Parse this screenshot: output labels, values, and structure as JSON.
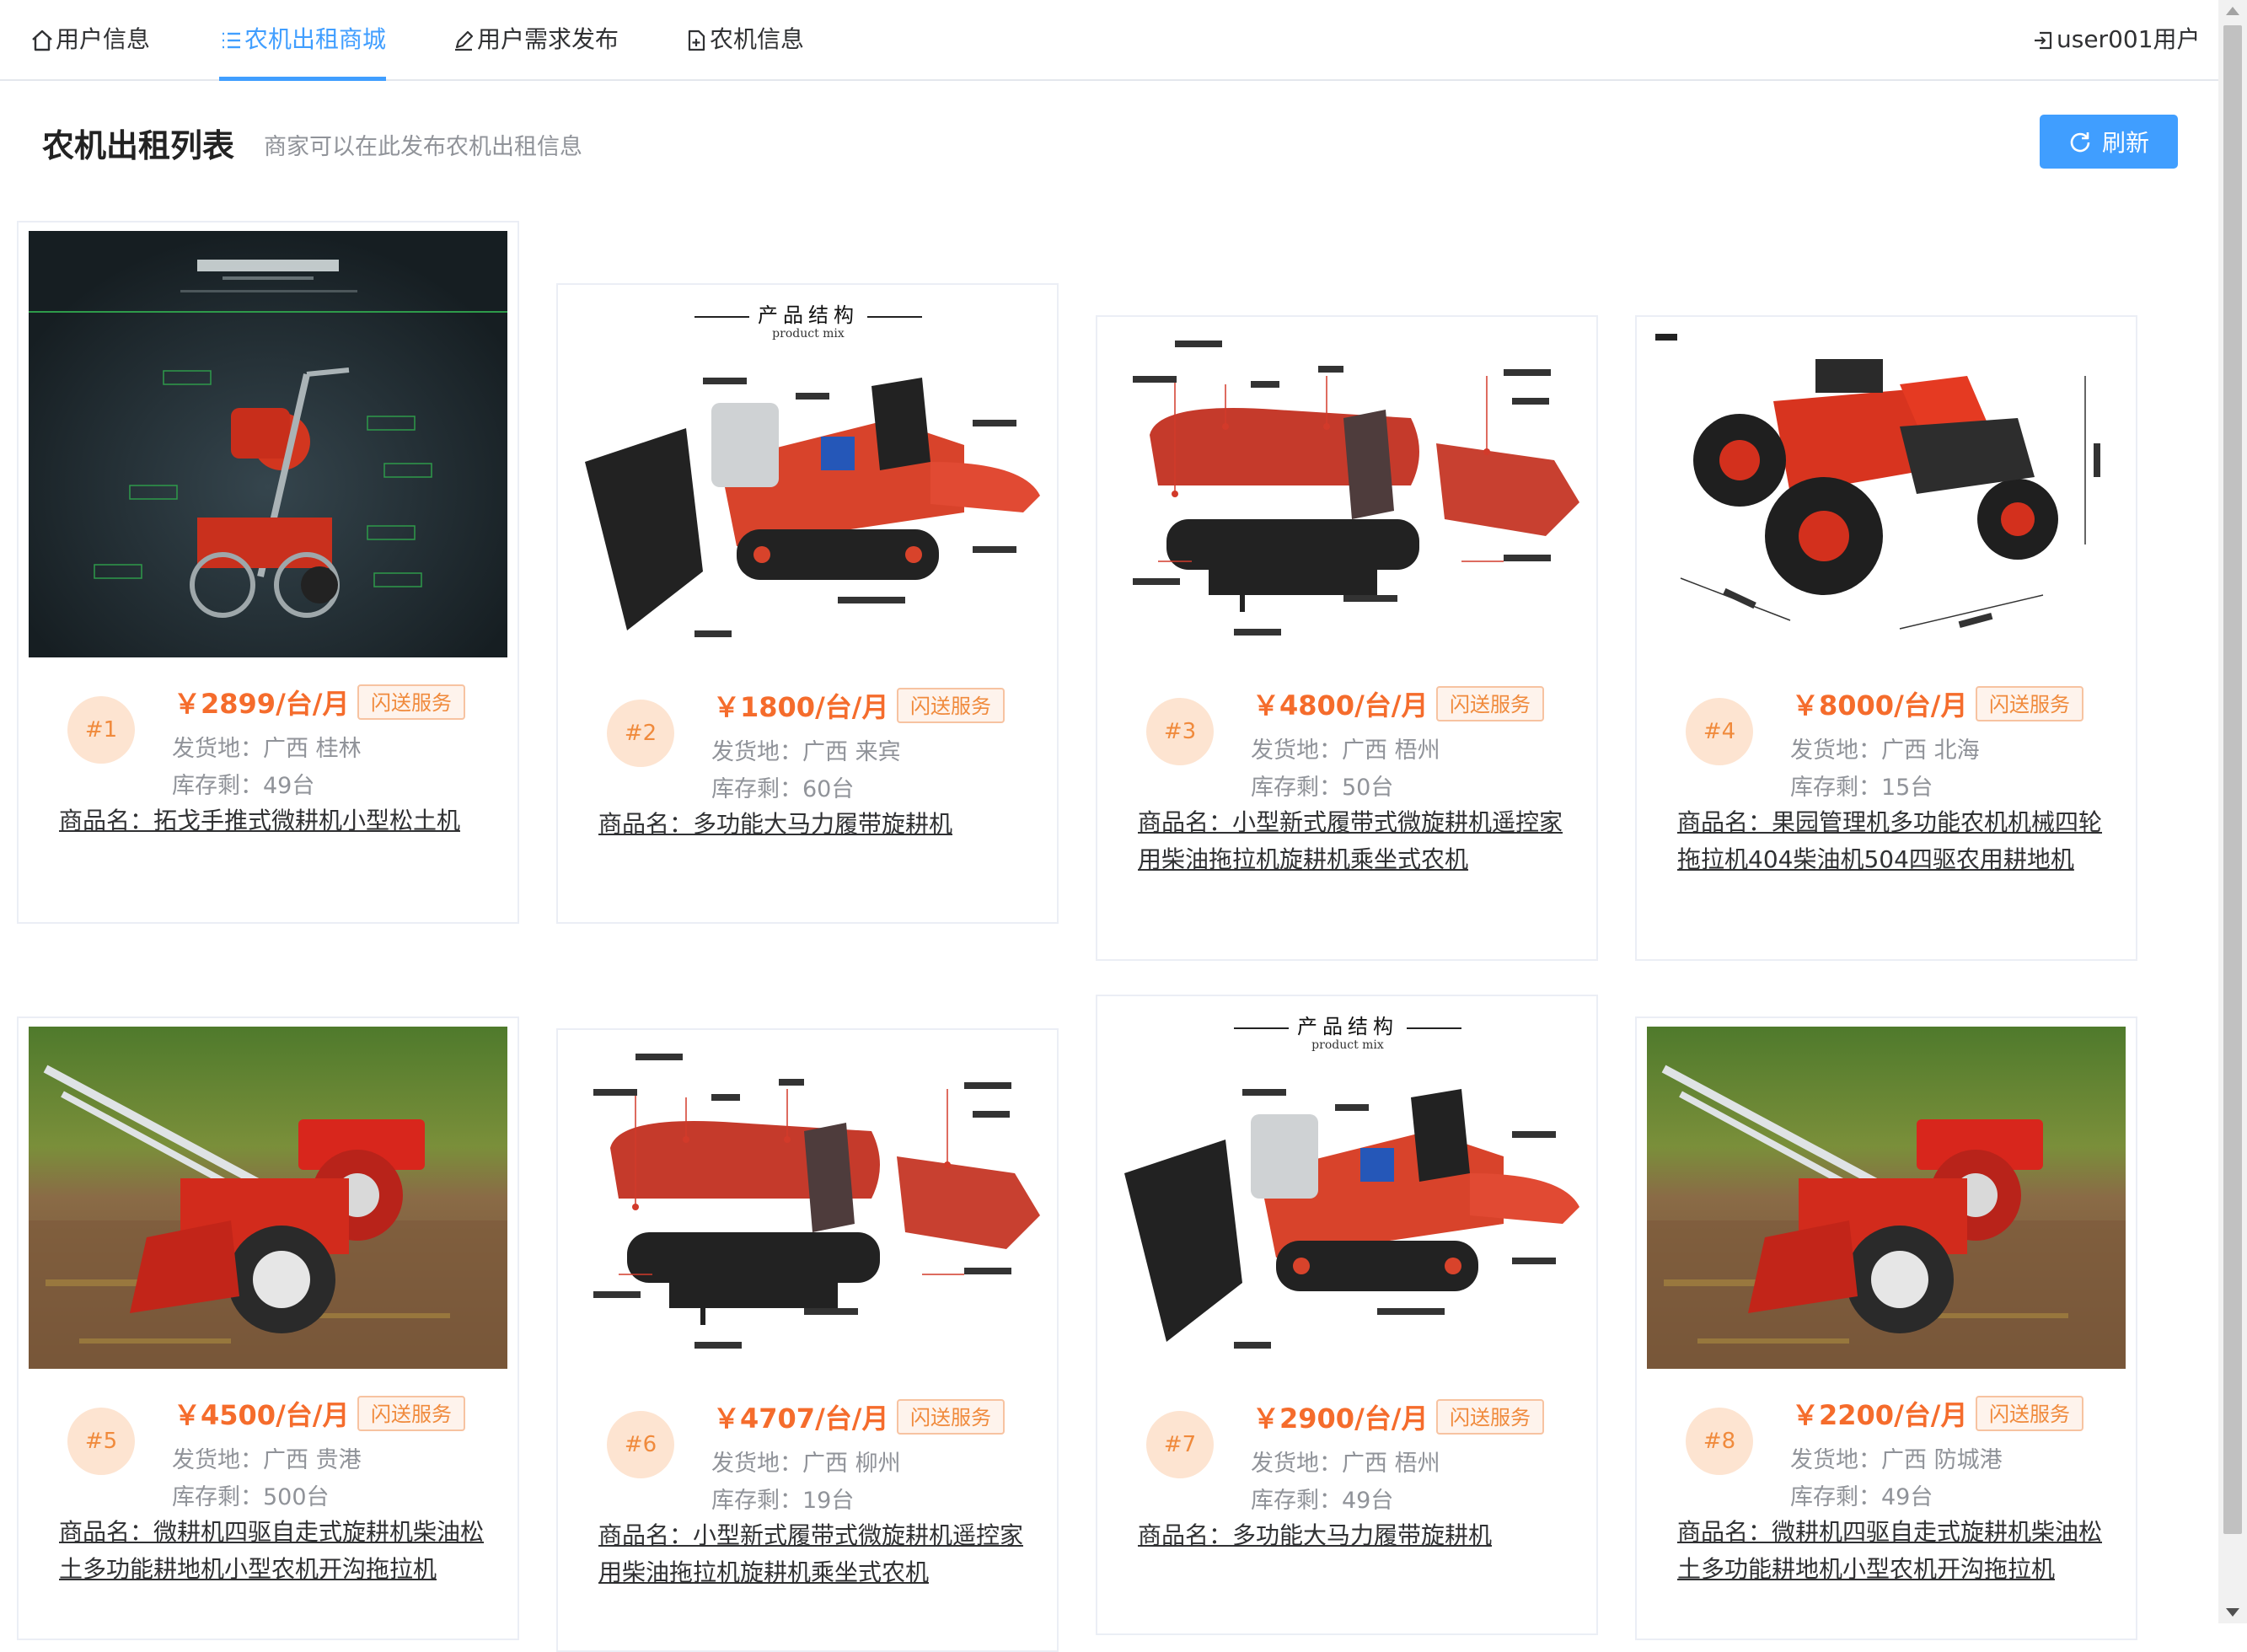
{
  "nav": {
    "items": [
      {
        "label": "用户信息",
        "icon": "home-icon"
      },
      {
        "label": "农机出租商城",
        "icon": "list-icon",
        "active": true
      },
      {
        "label": "用户需求发布",
        "icon": "edit-icon"
      },
      {
        "label": "农机信息",
        "icon": "document-add-icon"
      }
    ],
    "account": {
      "label": "user001用户",
      "icon": "logout-icon"
    }
  },
  "page": {
    "title": "农机出租列表",
    "subtitle": "商家可以在此发布农机出租信息",
    "refresh_label": "刷新"
  },
  "colors": {
    "primary": "#409eff",
    "price": "#f56c2c",
    "badge_bg": "#fde4d1",
    "tag_border": "#f7c3a1"
  },
  "products": [
    {
      "rank": "#1",
      "price": "￥2899/台/月",
      "tag": "闪送服务",
      "origin": "发货地：广西 桂林",
      "stock": "库存剩：49台",
      "name": "商品名：拓戈手推式微耕机小型松土机",
      "image": "tiller-feature-diagram"
    },
    {
      "rank": "#2",
      "price": "￥1800/台/月",
      "tag": "闪送服务",
      "origin": "发货地：广西 来宾",
      "stock": "库存剩：60台",
      "name": "商品名：多功能大马力履带旋耕机",
      "image": "crawler-product-structure",
      "image_text": {
        "heading": "产品结构",
        "sub": "product mix"
      }
    },
    {
      "rank": "#3",
      "price": "￥4800/台/月",
      "tag": "闪送服务",
      "origin": "发货地：广西 梧州",
      "stock": "库存剩：50台",
      "name": "商品名：小型新式履带式微旋耕机遥控家用柴油拖拉机旋耕机乘坐式农机",
      "image": "crawler-labeled-diagram"
    },
    {
      "rank": "#4",
      "price": "￥8000/台/月",
      "tag": "闪送服务",
      "origin": "发货地：广西 北海",
      "stock": "库存剩：15台",
      "name": "商品名：果园管理机多功能农机机械四轮拖拉机404柴油机504四驱农用耕地机",
      "image": "red-tractor"
    },
    {
      "rank": "#5",
      "price": "￥4500/台/月",
      "tag": "闪送服务",
      "origin": "发货地：广西 贵港",
      "stock": "库存剩：500台",
      "name": "商品名：微耕机四驱自走式旋耕机柴油松土多功能耕地机小型农机开沟拖拉机",
      "image": "tiller-in-field"
    },
    {
      "rank": "#6",
      "price": "￥4707/台/月",
      "tag": "闪送服务",
      "origin": "发货地：广西 柳州",
      "stock": "库存剩：19台",
      "name": "商品名：小型新式履带式微旋耕机遥控家用柴油拖拉机旋耕机乘坐式农机",
      "image": "crawler-labeled-diagram"
    },
    {
      "rank": "#7",
      "price": "￥2900/台/月",
      "tag": "闪送服务",
      "origin": "发货地：广西 梧州",
      "stock": "库存剩：49台",
      "name": "商品名：多功能大马力履带旋耕机",
      "image": "crawler-product-structure",
      "image_text": {
        "heading": "产品结构",
        "sub": "product mix"
      }
    },
    {
      "rank": "#8",
      "price": "￥2200/台/月",
      "tag": "闪送服务",
      "origin": "发货地：广西 防城港",
      "stock": "库存剩：49台",
      "name": "商品名：微耕机四驱自走式旋耕机柴油松土多功能耕地机小型农机开沟拖拉机",
      "image": "tiller-in-field"
    }
  ]
}
